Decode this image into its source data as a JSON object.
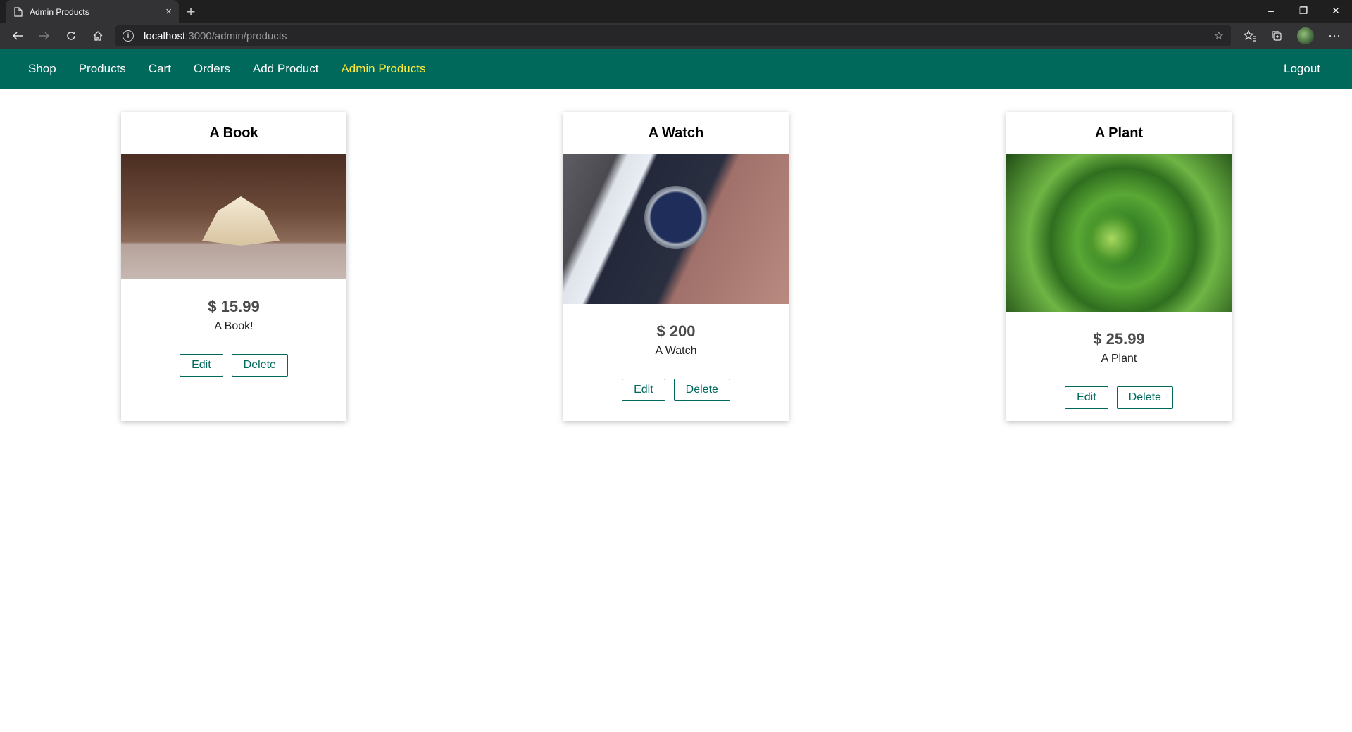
{
  "browser": {
    "tab_title": "Admin Products",
    "tab_close": "×",
    "new_tab": "+",
    "url_host": "localhost",
    "url_path": ":3000/admin/products",
    "window_controls": [
      "–",
      "❐",
      "✕"
    ]
  },
  "nav": {
    "items": [
      {
        "label": "Shop",
        "active": false
      },
      {
        "label": "Products",
        "active": false
      },
      {
        "label": "Cart",
        "active": false
      },
      {
        "label": "Orders",
        "active": false
      },
      {
        "label": "Add Product",
        "active": false
      },
      {
        "label": "Admin Products",
        "active": true
      }
    ],
    "logout": "Logout"
  },
  "colors": {
    "nav_bg": "#00695c",
    "nav_active": "#ffeb3b",
    "button_accent": "#00695c"
  },
  "products": [
    {
      "title": "A Book",
      "price": "$ 15.99",
      "description": "A Book!",
      "image_icon": "open-book-photo"
    },
    {
      "title": "A Watch",
      "price": "$ 200",
      "description": "A Watch",
      "image_icon": "wristwatch-photo"
    },
    {
      "title": "A Plant",
      "price": "$ 25.99",
      "description": "A Plant",
      "image_icon": "aloe-plant-photo"
    }
  ],
  "actions": {
    "edit": "Edit",
    "delete": "Delete"
  }
}
